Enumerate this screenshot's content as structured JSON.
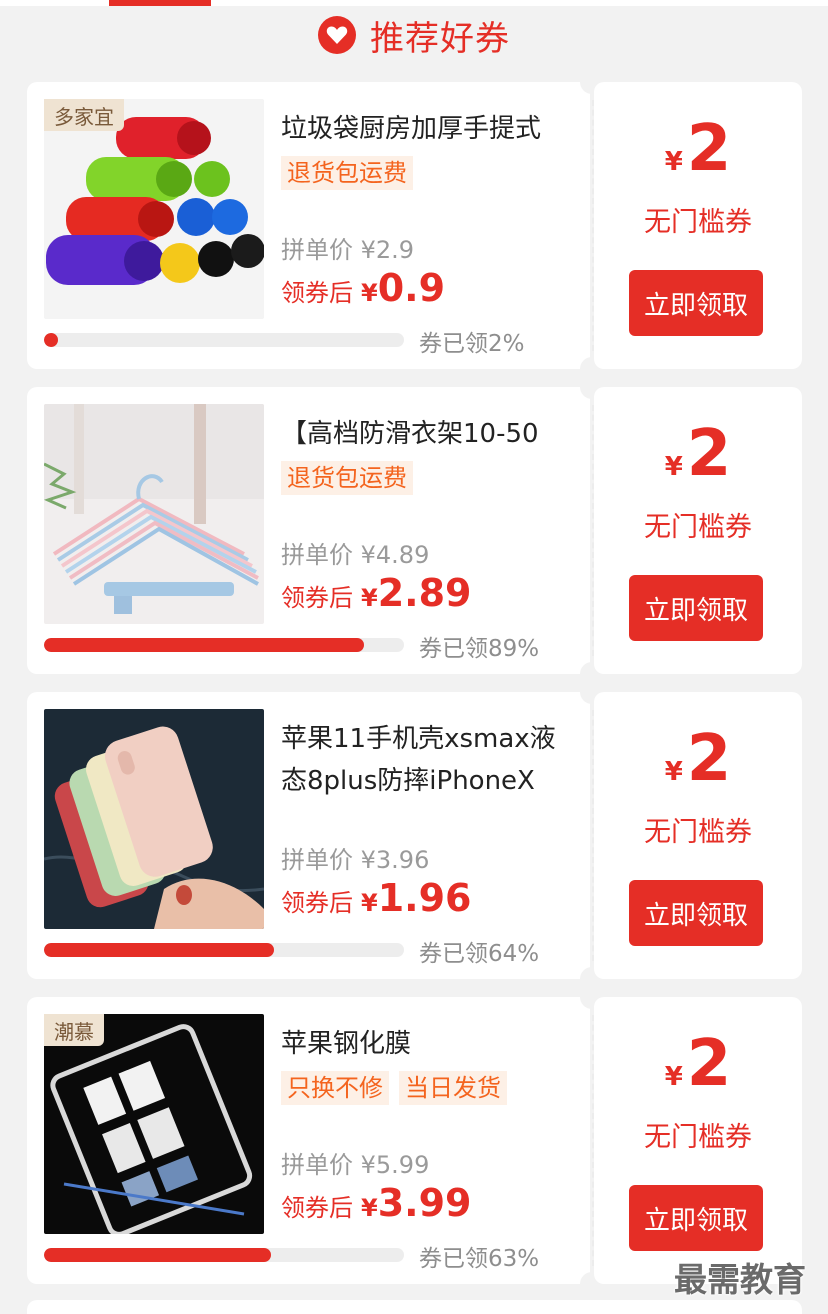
{
  "header": {
    "title": "推荐好券",
    "accent_color": "#e52e26",
    "icon": "heart-icon"
  },
  "coupons": [
    {
      "shop_tag": "多家宜",
      "title": "垃圾袋厨房加厚手提式",
      "tags": [
        "退货包运费"
      ],
      "original_price_label": "拼单价 ¥2.9",
      "after_label": "领券后",
      "after_yen": "¥",
      "after_price": "0.9",
      "progress_percent": 2,
      "progress_text": "券已领2%",
      "coupon_yen": "¥",
      "coupon_amount": "2",
      "coupon_type": "无门槛券",
      "button_label": "立即领取"
    },
    {
      "shop_tag": "",
      "title": "【高档防滑衣架10-50",
      "tags": [
        "退货包运费"
      ],
      "original_price_label": "拼单价 ¥4.89",
      "after_label": "领券后",
      "after_yen": "¥",
      "after_price": "2.89",
      "progress_percent": 89,
      "progress_text": "券已领89%",
      "coupon_yen": "¥",
      "coupon_amount": "2",
      "coupon_type": "无门槛券",
      "button_label": "立即领取"
    },
    {
      "shop_tag": "",
      "title": "苹果11手机壳xsmax液态8plus防摔iPhoneX",
      "tags": [],
      "original_price_label": "拼单价 ¥3.96",
      "after_label": "领券后",
      "after_yen": "¥",
      "after_price": "1.96",
      "progress_percent": 64,
      "progress_text": "券已领64%",
      "coupon_yen": "¥",
      "coupon_amount": "2",
      "coupon_type": "无门槛券",
      "button_label": "立即领取"
    },
    {
      "shop_tag": "潮慕",
      "title": "苹果钢化膜",
      "tags": [
        "只换不修",
        "当日发货"
      ],
      "original_price_label": "拼单价 ¥5.99",
      "after_label": "领券后",
      "after_yen": "¥",
      "after_price": "3.99",
      "progress_percent": 63,
      "progress_text": "券已领63%",
      "coupon_yen": "¥",
      "coupon_amount": "2",
      "coupon_type": "无门槛券",
      "button_label": "立即领取"
    }
  ],
  "watermark": "最需教育"
}
